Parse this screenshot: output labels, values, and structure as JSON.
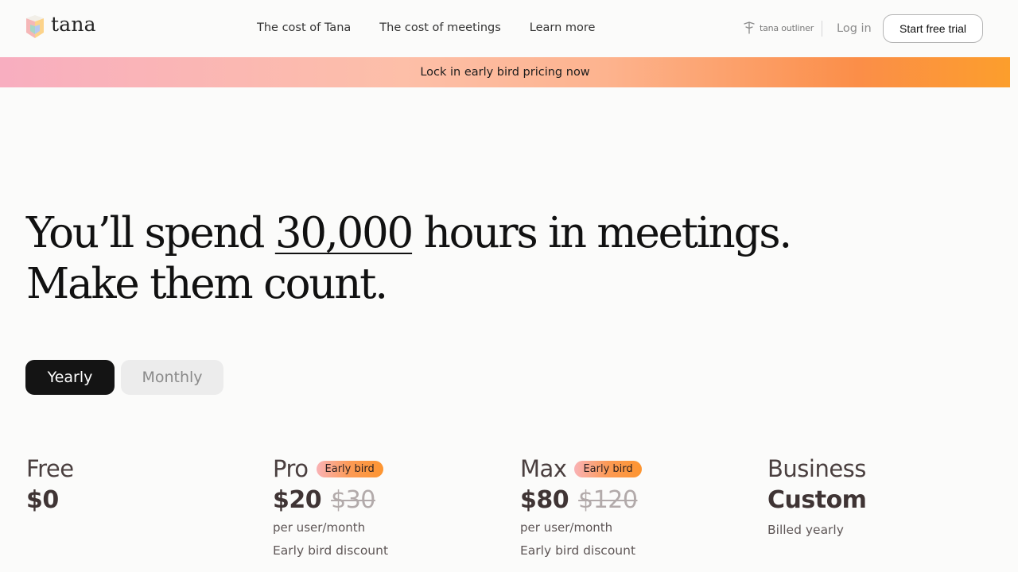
{
  "brand": {
    "name": "tana"
  },
  "nav": {
    "links": [
      "The cost of Tana",
      "The cost of meetings",
      "Learn more"
    ],
    "outliner_label": "tana outliner",
    "login_label": "Log in",
    "trial_label": "Start free trial"
  },
  "banner": {
    "text": "Lock in early bird pricing now"
  },
  "hero": {
    "line1_before": "You’ll spend ",
    "line1_highlight": "30,000",
    "line1_after": " hours in meetings.",
    "line2": "Make them count."
  },
  "billing": {
    "yearly": "Yearly",
    "monthly": "Monthly",
    "selected": "Yearly"
  },
  "plans": [
    {
      "name": "Free",
      "badge": "",
      "price": "$0",
      "old_price": "",
      "unit": "",
      "note": ""
    },
    {
      "name": "Pro",
      "badge": "Early bird",
      "price": "$20",
      "old_price": "$30",
      "unit": "per user/month",
      "note": "Early bird discount"
    },
    {
      "name": "Max",
      "badge": "Early bird",
      "price": "$80",
      "old_price": "$120",
      "unit": "per user/month",
      "note": "Early bird discount"
    },
    {
      "name": "Business",
      "badge": "",
      "price": "Custom",
      "old_price": "",
      "unit": "",
      "note": "Billed yearly"
    }
  ],
  "colors": {
    "banner_start": "#f8aec0",
    "banner_end": "#fc9e2c",
    "toggle_active": "#141414"
  }
}
